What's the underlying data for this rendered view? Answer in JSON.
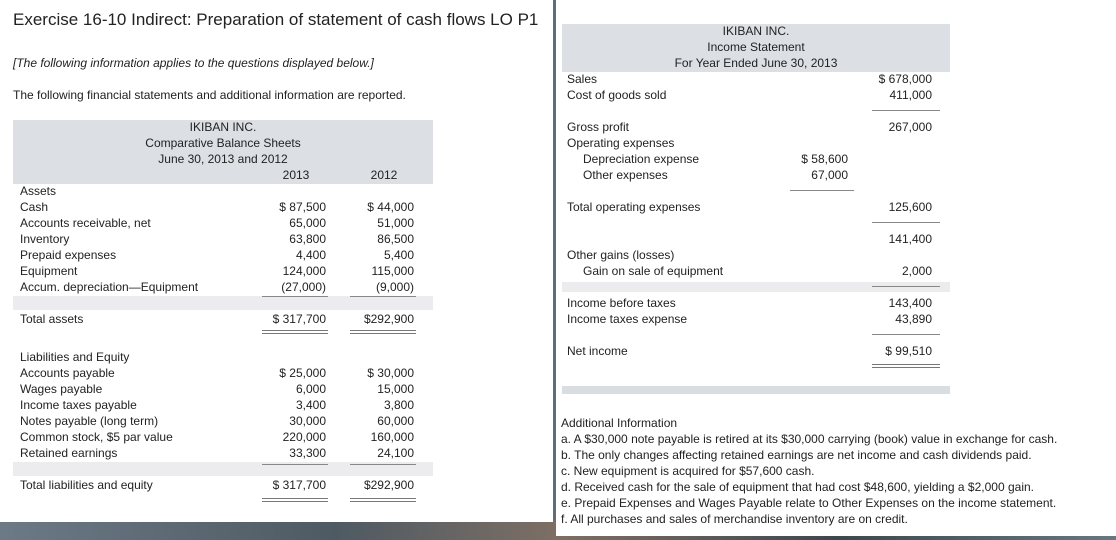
{
  "exercise": {
    "title": "Exercise 16-10 Indirect: Preparation of statement of cash flows LO P1",
    "note": "[The following information applies to the questions displayed below.]",
    "intro": "The following financial statements and additional information are reported."
  },
  "balance_sheet": {
    "company": "IKIBAN INC.",
    "title": "Comparative Balance Sheets",
    "dates": "June 30, 2013 and 2012",
    "col_2013": "2013",
    "col_2012": "2012",
    "assets_heading": "Assets",
    "assets": [
      {
        "label": "Cash",
        "y2013": "$ 87,500",
        "y2012": "$ 44,000"
      },
      {
        "label": "Accounts receivable, net",
        "y2013": "65,000",
        "y2012": "51,000"
      },
      {
        "label": "Inventory",
        "y2013": "63,800",
        "y2012": "86,500"
      },
      {
        "label": "Prepaid expenses",
        "y2013": "4,400",
        "y2012": "5,400"
      },
      {
        "label": "Equipment",
        "y2013": "124,000",
        "y2012": "115,000"
      },
      {
        "label": "Accum. depreciation—Equipment",
        "y2013": "(27,000)",
        "y2012": "(9,000)"
      }
    ],
    "total_assets": {
      "label": "Total assets",
      "y2013": "$ 317,700",
      "y2012": "$292,900"
    },
    "liab_heading": "Liabilities and Equity",
    "liabilities": [
      {
        "label": "Accounts payable",
        "y2013": "$ 25,000",
        "y2012": "$ 30,000"
      },
      {
        "label": "Wages payable",
        "y2013": "6,000",
        "y2012": "15,000"
      },
      {
        "label": "Income taxes payable",
        "y2013": "3,400",
        "y2012": "3,800"
      },
      {
        "label": "Notes payable (long term)",
        "y2013": "30,000",
        "y2012": "60,000"
      },
      {
        "label": "Common stock, $5 par value",
        "y2013": "220,000",
        "y2012": "160,000"
      },
      {
        "label": "Retained earnings",
        "y2013": "33,300",
        "y2012": "24,100"
      }
    ],
    "total_liab": {
      "label": "Total liabilities and equity",
      "y2013": "$ 317,700",
      "y2012": "$292,900"
    }
  },
  "income_statement": {
    "company": "IKIBAN INC.",
    "title": "Income Statement",
    "period": "For Year Ended June 30, 2013",
    "sales_label": "Sales",
    "sales": "$ 678,000",
    "cogs_label": "Cost of goods sold",
    "cogs": "411,000",
    "gross_label": "Gross profit",
    "gross": "267,000",
    "opex_label": "Operating expenses",
    "dep_label": "Depreciation expense",
    "dep": "$ 58,600",
    "other_exp_label": "Other expenses",
    "other_exp": "67,000",
    "total_opex_label": "Total operating expenses",
    "total_opex": "125,600",
    "subtotal": "141,400",
    "other_gains_label": "Other gains (losses)",
    "gain_label": "Gain on sale of equipment",
    "gain": "2,000",
    "ibt_label": "Income before taxes",
    "ibt": "143,400",
    "tax_label": "Income taxes expense",
    "tax": "43,890",
    "net_label": "Net income",
    "net": "$ 99,510"
  },
  "additional": {
    "heading": "Additional Information",
    "items": [
      "a. A $30,000 note payable is retired at its $30,000 carrying (book) value in exchange for cash.",
      "b. The only changes affecting retained earnings are net income and cash dividends paid.",
      "c. New equipment is acquired for $57,600 cash.",
      "d. Received cash for the sale of equipment that had cost $48,600, yielding a $2,000 gain.",
      "e. Prepaid Expenses and Wages Payable relate to Other Expenses on the income statement.",
      "f. All purchases and sales of merchandise inventory are on credit."
    ]
  }
}
